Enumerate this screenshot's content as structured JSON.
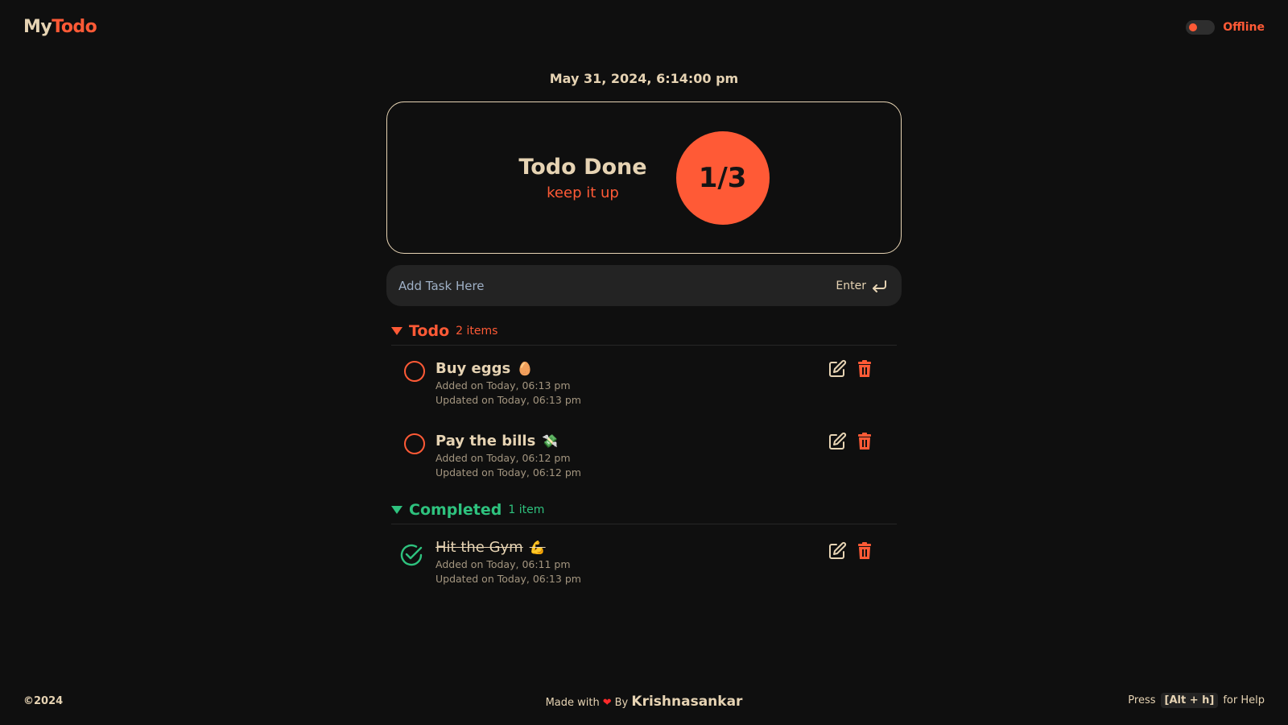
{
  "header": {
    "logo_part1": "My",
    "logo_part2": "Todo",
    "network_status": "Offline"
  },
  "datetime": "May 31, 2024, 6:14:00 pm",
  "summary": {
    "title": "Todo Done",
    "subtitle": "keep it up",
    "progress_label": "1/3",
    "done": 1,
    "total": 3
  },
  "add_task": {
    "placeholder": "Add Task Here",
    "value": "",
    "enter_label": "Enter"
  },
  "sections": {
    "todo": {
      "title": "Todo",
      "count_label": "2 items",
      "items": [
        {
          "name": "Buy eggs",
          "emoji": "🥚",
          "added": "Added on Today, 06:13 pm",
          "updated": "Updated on Today, 06:13 pm"
        },
        {
          "name": "Pay the bills",
          "emoji": "💸",
          "added": "Added on Today, 06:12 pm",
          "updated": "Updated on Today, 06:12 pm"
        }
      ]
    },
    "completed": {
      "title": "Completed",
      "count_label": "1 item",
      "items": [
        {
          "name": "Hit the Gym",
          "emoji": "💪",
          "added": "Added on Today, 06:11 pm",
          "updated": "Updated on Today, 06:13 pm"
        }
      ]
    }
  },
  "footer": {
    "copyright": "©2024",
    "made_with": "Made with",
    "by": "By",
    "author": "Krishnasankar",
    "help_press": "Press",
    "help_keys": "[Alt + h]",
    "help_suffix": "for Help"
  },
  "colors": {
    "background": "#0f0f0f",
    "accent": "#ff5a36",
    "success": "#2ec27e",
    "text": "#e6d3b3"
  },
  "icons": [
    "edit-icon",
    "trash-icon",
    "caret-down-icon",
    "enter-icon",
    "check-circle-icon",
    "heart-icon"
  ]
}
